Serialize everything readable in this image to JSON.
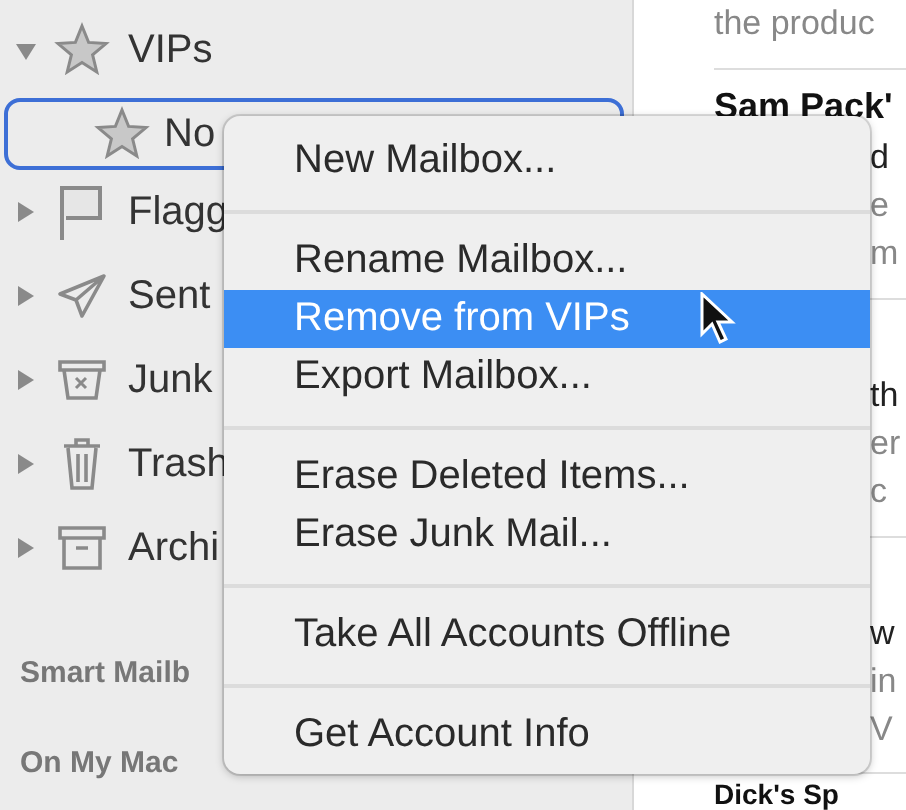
{
  "sidebar": {
    "items": [
      {
        "label": "VIPs",
        "expanded": true,
        "selected": false,
        "children": [
          {
            "label": "No",
            "selected": true
          }
        ]
      },
      {
        "label": "Flagg",
        "expanded": false,
        "selected": false
      },
      {
        "label": "Sent",
        "expanded": false,
        "selected": false
      },
      {
        "label": "Junk",
        "expanded": false,
        "selected": false
      },
      {
        "label": "Trash",
        "expanded": false,
        "selected": false
      },
      {
        "label": "Archi",
        "expanded": false,
        "selected": false
      }
    ],
    "sections": [
      "Smart Mailb",
      "On My Mac"
    ]
  },
  "message_list": {
    "top": [
      {
        "text": "the produc",
        "kind": "preview"
      },
      {
        "text": "Sam Pack'",
        "kind": "sender"
      }
    ],
    "fragments": [
      {
        "text": "d",
        "kind": "subject"
      },
      {
        "text": "e",
        "kind": "preview"
      },
      {
        "text": "m",
        "kind": "preview"
      },
      {
        "kind": "divider"
      },
      {
        "text": "th",
        "kind": "subject"
      },
      {
        "text": "er",
        "kind": "preview"
      },
      {
        "text": "c",
        "kind": "preview"
      },
      {
        "kind": "divider"
      },
      {
        "text": "w",
        "kind": "subject"
      },
      {
        "text": "in",
        "kind": "preview"
      },
      {
        "text": "V",
        "kind": "preview"
      }
    ],
    "bottom": [
      {
        "text": "Dick's Sp",
        "kind": "sender"
      }
    ]
  },
  "context_menu": {
    "items": [
      {
        "kind": "item",
        "label": "New Mailbox...",
        "selected": false
      },
      {
        "kind": "separator"
      },
      {
        "kind": "item",
        "label": "Rename Mailbox...",
        "selected": false
      },
      {
        "kind": "item",
        "label": "Remove from VIPs",
        "selected": true
      },
      {
        "kind": "item",
        "label": "Export Mailbox...",
        "selected": false
      },
      {
        "kind": "separator"
      },
      {
        "kind": "item",
        "label": "Erase Deleted Items...",
        "selected": false
      },
      {
        "kind": "item",
        "label": "Erase Junk Mail...",
        "selected": false
      },
      {
        "kind": "separator"
      },
      {
        "kind": "item",
        "label": "Take All Accounts Offline",
        "selected": false
      },
      {
        "kind": "separator"
      },
      {
        "kind": "item",
        "label": "Get Account Info",
        "selected": false
      }
    ]
  }
}
